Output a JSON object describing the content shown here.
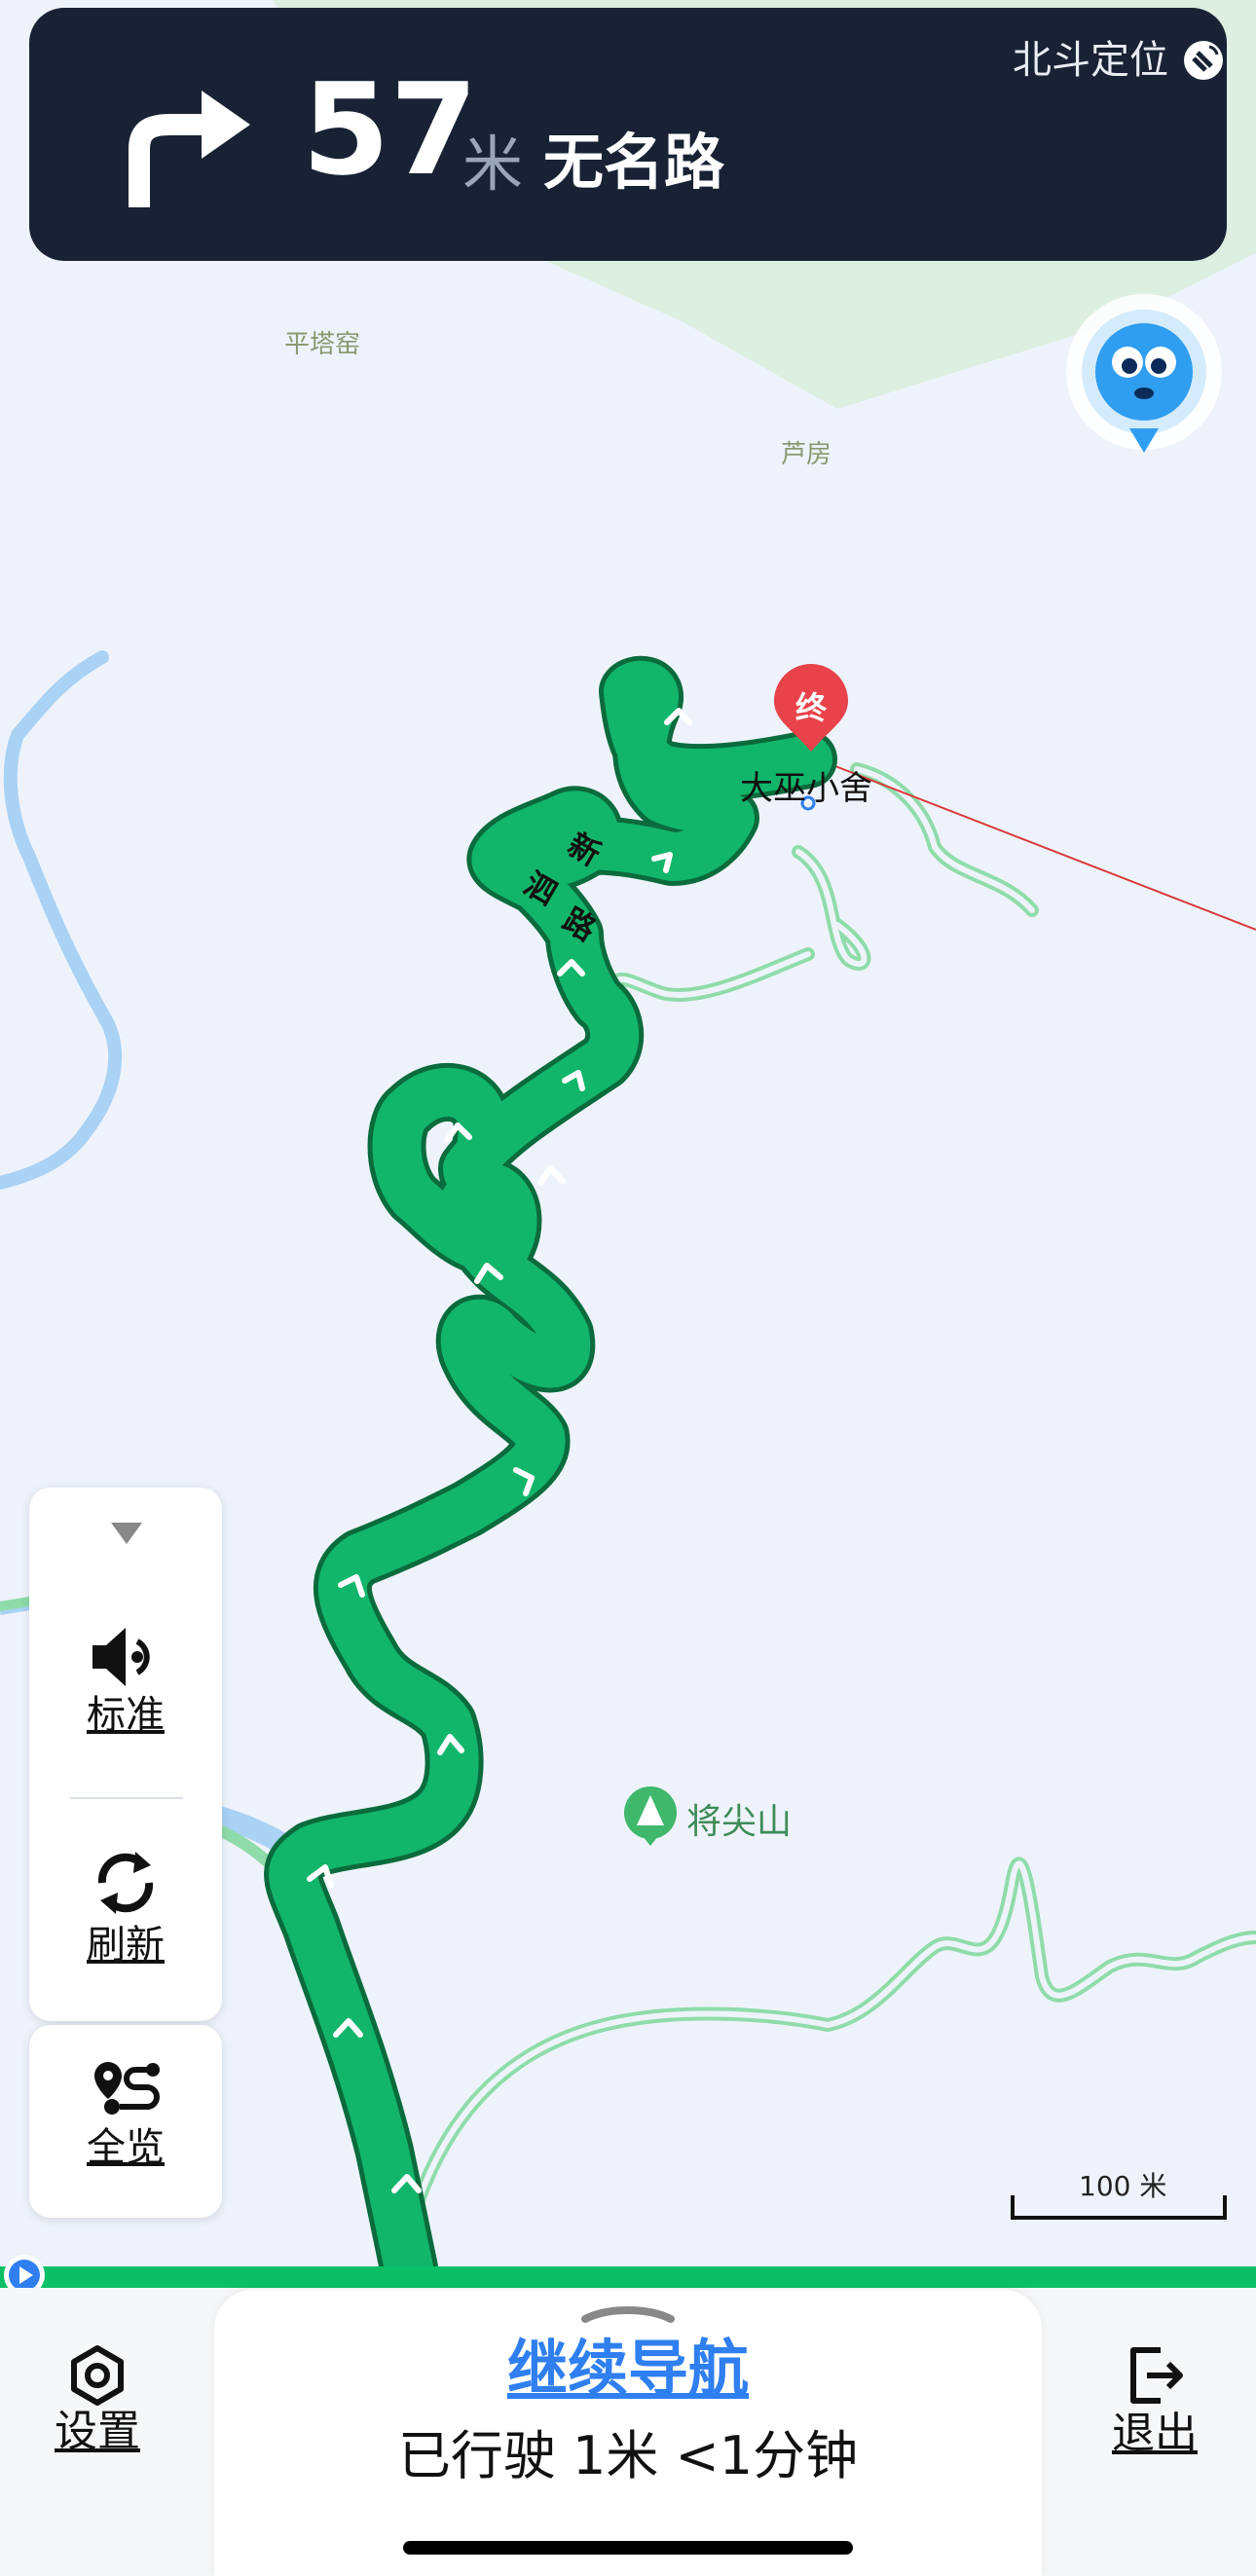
{
  "navigation": {
    "turn_icon": "turn-right-arrow",
    "distance_value": "57",
    "distance_unit": "米",
    "road_name": "无名路",
    "positioning_text": "北斗定位"
  },
  "map": {
    "labels": {
      "village_1": "平塔窑",
      "village_2": "芦房",
      "road": [
        "新",
        "泗",
        "路"
      ],
      "destination_marker": "终",
      "destination_name": "大巫小舍",
      "poi_name": "将尖山"
    },
    "scale": "100 米",
    "colors": {
      "route": "#12b66a",
      "route_outline": "#0a6b3c",
      "water": "#a9d2f5",
      "green_area": "#dcefe0",
      "destination": "#e8424b"
    }
  },
  "side_panel": {
    "voice_label": "标准",
    "refresh_label": "刷新",
    "overview_label": "全览"
  },
  "bottom": {
    "settings_label": "设置",
    "continue_label": "继续导航",
    "trip_status": "已行驶 1米 <1分钟",
    "exit_label": "退出"
  }
}
